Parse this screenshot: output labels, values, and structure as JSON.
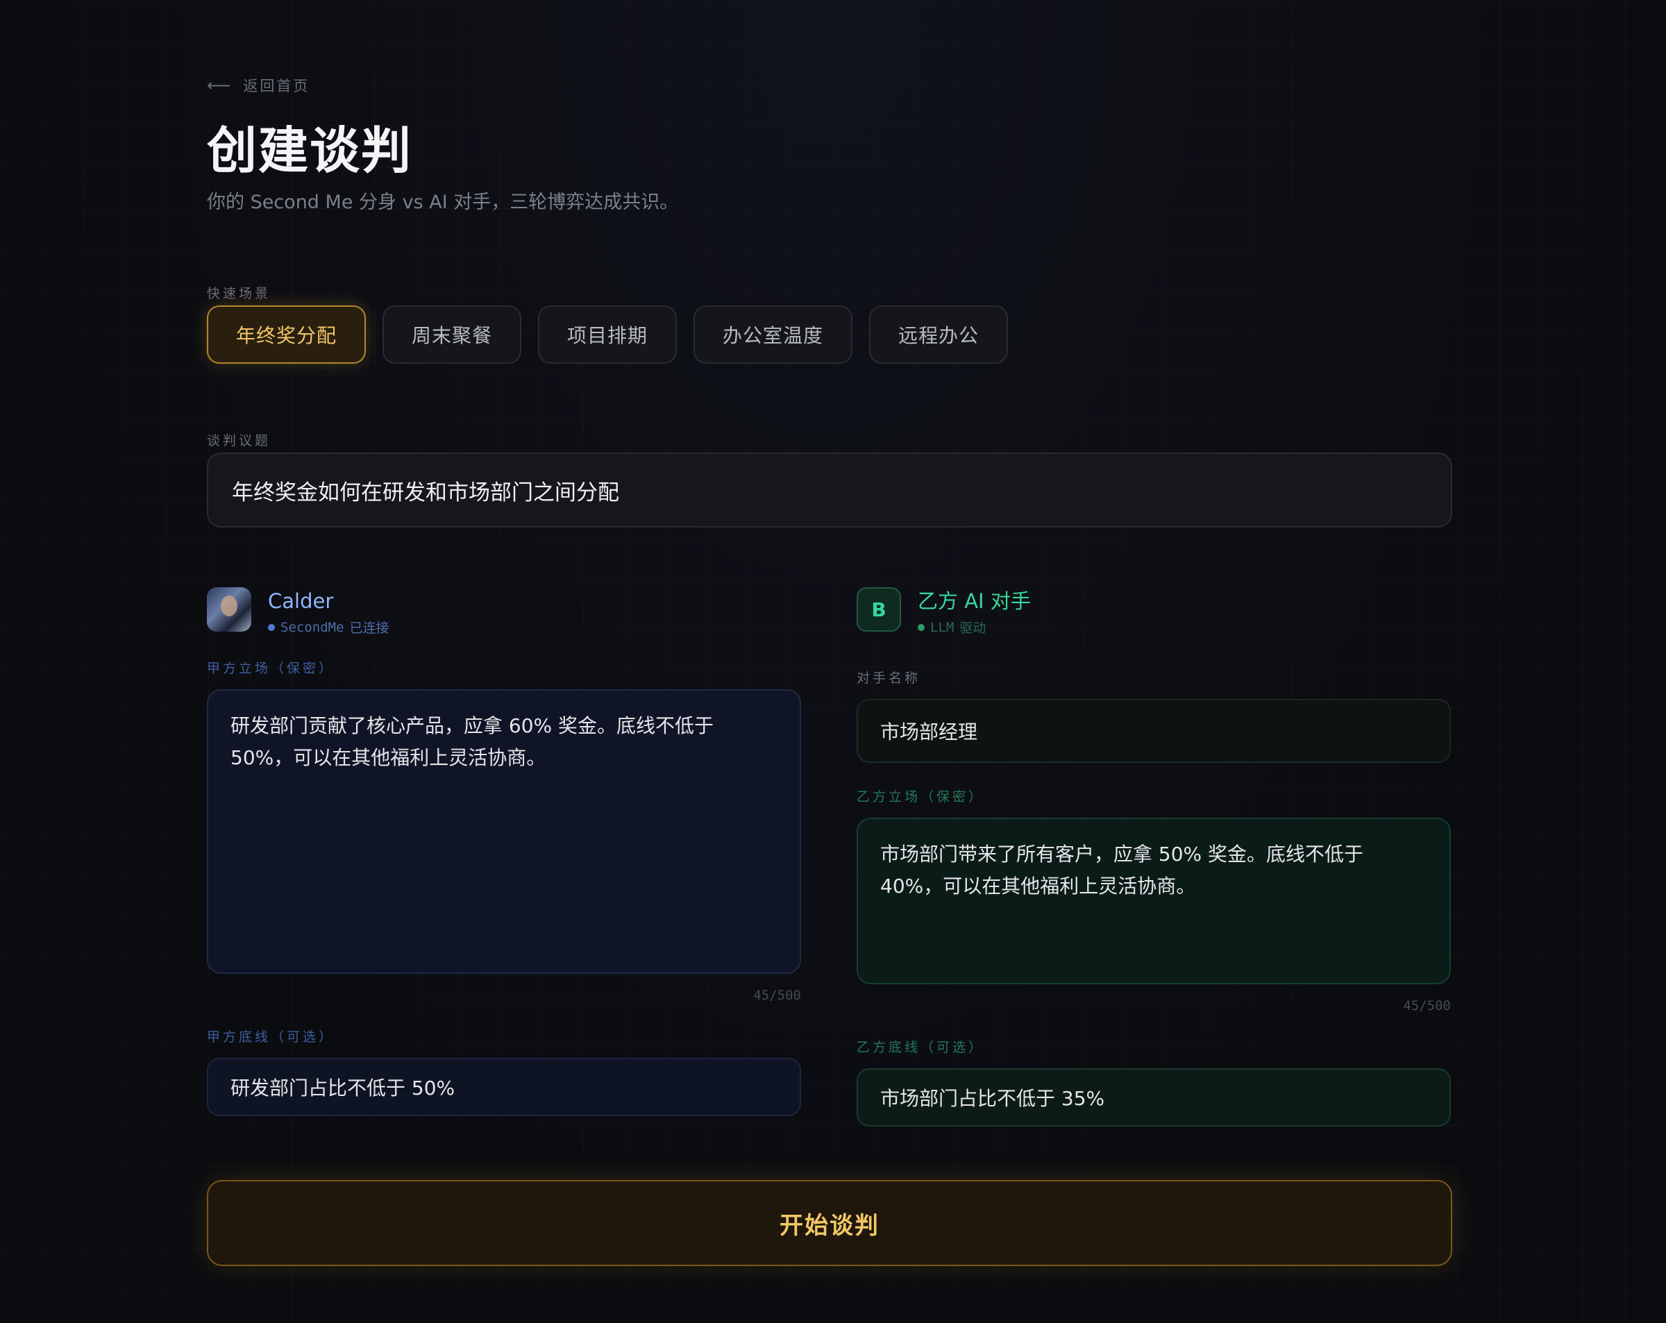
{
  "nav": {
    "back_arrow": "⟵",
    "back_label": "返回首页"
  },
  "header": {
    "title": "创建谈判",
    "subtitle": "你的 Second Me 分身 vs AI 对手，三轮博弈达成共识。"
  },
  "scenarios": {
    "label": "快速场景",
    "items": [
      {
        "label": "年终奖分配",
        "active": true
      },
      {
        "label": "周末聚餐",
        "active": false
      },
      {
        "label": "项目排期",
        "active": false
      },
      {
        "label": "办公室温度",
        "active": false
      },
      {
        "label": "远程办公",
        "active": false
      }
    ]
  },
  "topic": {
    "label": "谈判议题",
    "value": "年终奖金如何在研发和市场部门之间分配"
  },
  "party_a": {
    "name": "Calder",
    "status_source": "SecondMe",
    "status_text": "已连接",
    "stance_label": "甲方立场（保密）",
    "stance_value": "研发部门贡献了核心产品，应拿 60% 奖金。底线不低于 50%，可以在其他福利上灵活协商。",
    "counter": "45/500",
    "bottom_label": "甲方底线（可选）",
    "bottom_value": "研发部门占比不低于 50%"
  },
  "party_b": {
    "badge": "B",
    "name": "乙方 AI 对手",
    "status_source": "LLM",
    "status_text": "驱动",
    "opponent_label": "对手名称",
    "opponent_value": "市场部经理",
    "stance_label": "乙方立场（保密）",
    "stance_value": "市场部门带来了所有客户，应拿 50% 奖金。底线不低于 40%，可以在其他福利上灵活协商。",
    "counter": "45/500",
    "bottom_label": "乙方底线（可选）",
    "bottom_value": "市场部门占比不低于 35%"
  },
  "actions": {
    "start_label": "开始谈判"
  },
  "colors": {
    "accent": "#f2c766",
    "party_a": "#8fb5ff",
    "party_b": "#39d69c"
  }
}
